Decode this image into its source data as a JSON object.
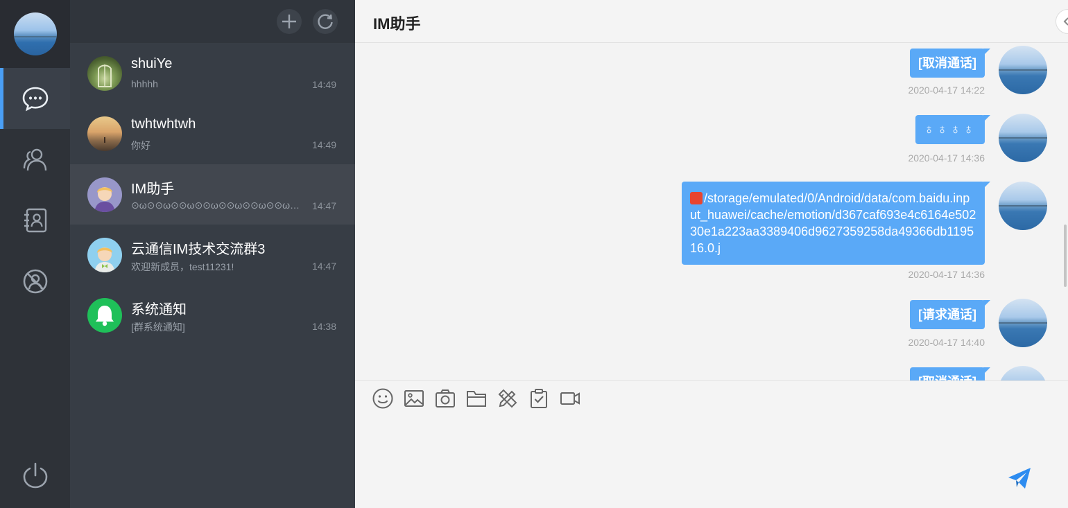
{
  "rail": {
    "items": [
      {
        "icon": "chat-bubble-icon",
        "active": true
      },
      {
        "icon": "contacts-icon",
        "active": false
      },
      {
        "icon": "address-book-icon",
        "active": false
      },
      {
        "icon": "blocked-user-icon",
        "active": false
      }
    ],
    "logout_icon": "power-icon"
  },
  "conversations": [
    {
      "name": "shuiYe",
      "last_message": "hhhhh",
      "time": "14:49"
    },
    {
      "name": "twhtwhtwh",
      "last_message": "你好",
      "time": "14:49"
    },
    {
      "name": "IM助手",
      "last_message": "⊙ω⊙⊙ω⊙⊙ω⊙⊙ω⊙⊙ω⊙⊙ω⊙⊙ω⊙⊙ω⊙",
      "time": "14:47"
    },
    {
      "name": "云通信IM技术交流群3",
      "last_message": "欢迎新成员，test11231!",
      "time": "14:47"
    },
    {
      "name": "系统通知",
      "last_message": "[群系统通知]",
      "time": "14:38"
    }
  ],
  "chat": {
    "title": "IM助手",
    "messages": [
      {
        "text": "[取消通话]",
        "time": "2020-04-17 14:22"
      },
      {
        "text": "♁♁♁♁",
        "time": "2020-04-17 14:36"
      },
      {
        "text": "/storage/emulated/0/Android/data/com.baidu.input_huawei/cache/emotion/d367caf693e4c6164e50230e1a223aa3389406d9627359258da49366db119516.0.j",
        "time": "2020-04-17 14:36"
      },
      {
        "text": "[请求通话]",
        "time": "2020-04-17 14:40"
      },
      {
        "text": "[取消通话]",
        "time": ""
      }
    ],
    "toolbar": [
      "emoji-icon",
      "image-icon",
      "camera-icon",
      "folder-icon",
      "draw-icon",
      "clipboard-check-icon",
      "video-call-icon"
    ]
  },
  "colors": {
    "accent": "#4a9ff5",
    "bubble": "#5aa9f7",
    "rail_bg": "#2e3238",
    "list_bg": "#373d45"
  }
}
